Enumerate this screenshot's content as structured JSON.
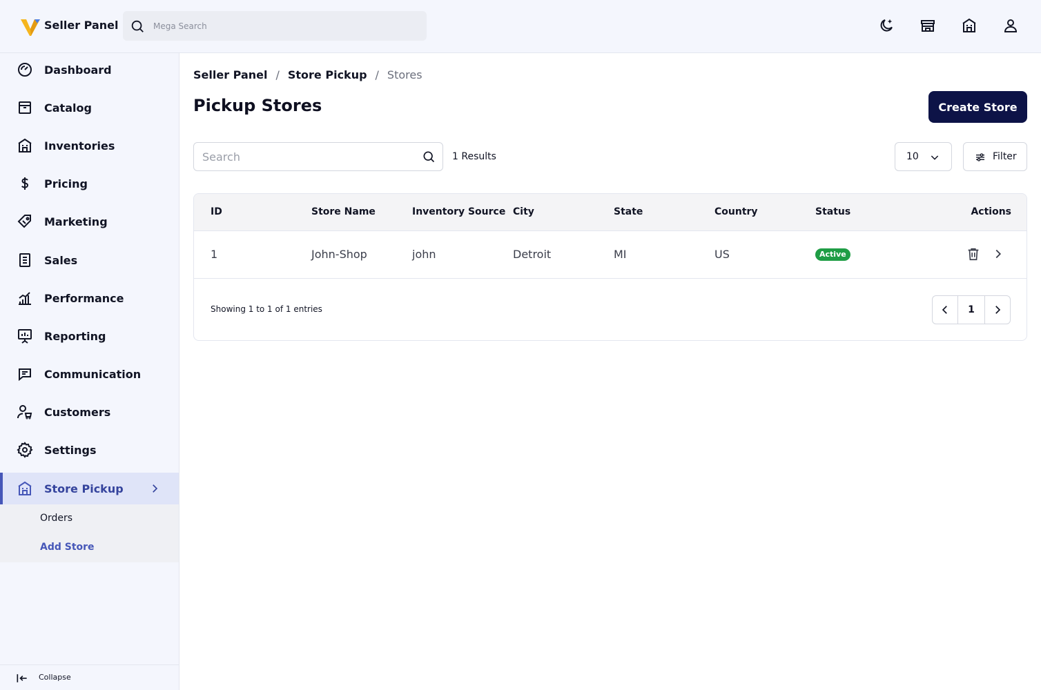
{
  "app": {
    "brand": "Seller Panel"
  },
  "search": {
    "placeholder": "Mega Search"
  },
  "topbar_icons": [
    "moon-icon",
    "storefront-icon",
    "store-building-icon",
    "user-icon"
  ],
  "sidebar": {
    "items": [
      {
        "label": "Dashboard",
        "icon": "dashboard-gauge-icon"
      },
      {
        "label": "Catalog",
        "icon": "catalog-box-icon"
      },
      {
        "label": "Inventories",
        "icon": "inventory-building-icon"
      },
      {
        "label": "Pricing",
        "icon": "dollar-icon"
      },
      {
        "label": "Marketing",
        "icon": "tag-icon"
      },
      {
        "label": "Sales",
        "icon": "receipt-icon"
      },
      {
        "label": "Performance",
        "icon": "bar-chart-icon"
      },
      {
        "label": "Reporting",
        "icon": "presentation-icon"
      },
      {
        "label": "Communication",
        "icon": "chat-icon"
      },
      {
        "label": "Customers",
        "icon": "customers-icon"
      },
      {
        "label": "Settings",
        "icon": "gear-icon"
      },
      {
        "label": "Store Pickup",
        "icon": "store-building-icon",
        "active": true
      }
    ],
    "submenu": [
      {
        "label": "Orders"
      },
      {
        "label": "Add Store",
        "active": true
      }
    ],
    "collapse_label": "Collapse"
  },
  "breadcrumb": {
    "items": [
      "Seller Panel",
      "Store Pickup",
      "Stores"
    ],
    "separator": "/"
  },
  "page": {
    "title": "Pickup Stores",
    "create_button": "Create Store",
    "search_placeholder": "Search",
    "results": "1 Results",
    "per_page": "10",
    "filter_label": "Filter"
  },
  "table": {
    "columns": [
      "ID",
      "Store Name",
      "Inventory Source",
      "City",
      "State",
      "Country",
      "Status",
      "Actions"
    ],
    "rows": [
      {
        "id": "1",
        "store_name": "John-Shop",
        "inventory_source": "john",
        "city": "Detroit",
        "state": "MI",
        "country": "US",
        "status": "Active"
      }
    ],
    "showing": "Showing 1 to 1 of 1 entries",
    "current_page": "1"
  },
  "colors": {
    "primary": "#0d1347",
    "accent": "#4657b8",
    "success": "#1f9d45",
    "logo_yellow": "#f5b51e",
    "logo_blue": "#4a7ee6"
  }
}
